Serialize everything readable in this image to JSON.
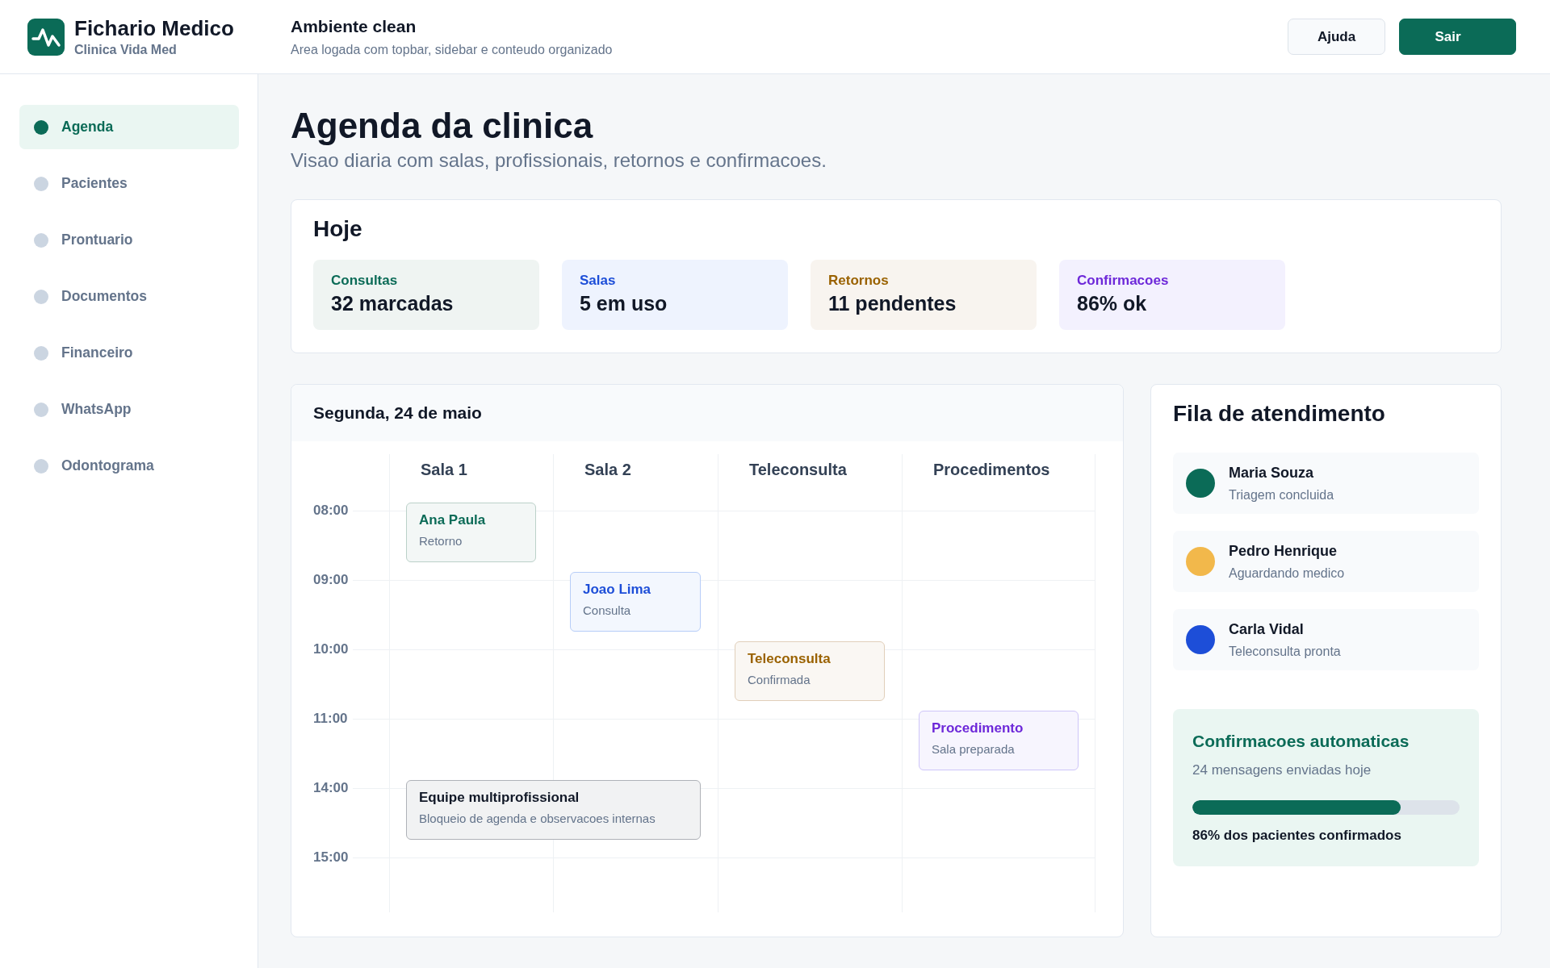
{
  "brand": {
    "title": "Fichario Medico",
    "subtitle": "Clinica Vida Med"
  },
  "topbar": {
    "title": "Ambiente clean",
    "subtitle": "Area logada com topbar, sidebar e conteudo organizado",
    "buttons": [
      {
        "label": "Ajuda",
        "kind": "secondary"
      },
      {
        "label": "Sair",
        "kind": "primary"
      }
    ]
  },
  "sidebar": {
    "items": [
      {
        "label": "Agenda",
        "selected": true
      },
      {
        "label": "Pacientes",
        "selected": false
      },
      {
        "label": "Prontuario",
        "selected": false
      },
      {
        "label": "Documentos",
        "selected": false
      },
      {
        "label": "Financeiro",
        "selected": false
      },
      {
        "label": "WhatsApp",
        "selected": false
      },
      {
        "label": "Odontograma",
        "selected": false
      }
    ]
  },
  "page": {
    "title": "Agenda da clinica",
    "subtitle": "Visao diaria com salas, profissionais, retornos e confirmacoes."
  },
  "today": {
    "title": "Hoje",
    "stats": [
      {
        "label": "Consultas",
        "value": "32 marcadas",
        "color": "#0b6b57"
      },
      {
        "label": "Salas",
        "value": "5 em uso",
        "color": "#1d4ed8"
      },
      {
        "label": "Retornos",
        "value": "11 pendentes",
        "color": "#9a6200"
      },
      {
        "label": "Confirmacoes",
        "value": "86% ok",
        "color": "#6d28d9"
      }
    ]
  },
  "calendar": {
    "date": "Segunda, 24 de maio",
    "columns": [
      "Sala 1",
      "Sala 2",
      "Teleconsulta",
      "Procedimentos"
    ],
    "rows": [
      {
        "time": "08:00",
        "slots": [
          {
            "kind": "appointment",
            "title": "Ana Paula",
            "detail": "Retorno",
            "color": "#0b6b57",
            "wide": false
          },
          {
            "kind": "free"
          },
          {
            "kind": "free"
          },
          {
            "kind": "free"
          }
        ]
      },
      {
        "time": "09:00",
        "slots": [
          {
            "kind": "free"
          },
          {
            "kind": "appointment",
            "title": "Joao Lima",
            "detail": "Consulta",
            "color": "#1d4ed8",
            "wide": false
          },
          {
            "kind": "free"
          },
          {
            "kind": "free"
          }
        ]
      },
      {
        "time": "10:00",
        "slots": [
          {
            "kind": "free"
          },
          {
            "kind": "free"
          },
          {
            "kind": "appointment",
            "title": "Teleconsulta",
            "detail": "Confirmada",
            "color": "#9a6200",
            "wide": false
          },
          {
            "kind": "free"
          }
        ]
      },
      {
        "time": "11:00",
        "slots": [
          {
            "kind": "free"
          },
          {
            "kind": "free"
          },
          {
            "kind": "free"
          },
          {
            "kind": "appointment",
            "title": "Procedimento",
            "detail": "Sala preparada",
            "color": "#6d28d9",
            "wide": false
          }
        ]
      },
      {
        "time": "14:00",
        "slots": [
          {
            "kind": "appointment",
            "title": "Equipe multiprofissional",
            "detail": "Bloqueio de agenda e observacoes internas",
            "color": "#111827",
            "wide": true
          },
          {
            "kind": "free"
          },
          {
            "kind": "free"
          },
          {
            "kind": "free"
          }
        ]
      },
      {
        "time": "15:00",
        "slots": [
          {
            "kind": "free"
          },
          {
            "kind": "free"
          },
          {
            "kind": "free"
          },
          {
            "kind": "free"
          }
        ]
      }
    ]
  },
  "queue": {
    "title": "Fila de atendimento",
    "items": [
      {
        "name": "Maria Souza",
        "status": "Triagem concluida",
        "color": "#0b6b57"
      },
      {
        "name": "Pedro Henrique",
        "status": "Aguardando medico",
        "color": "#f2b84b"
      },
      {
        "name": "Carla Vidal",
        "status": "Teleconsulta pronta",
        "color": "#1d4ed8"
      }
    ],
    "confirmations": {
      "title": "Confirmacoes automaticas",
      "text": "24 mensagens enviadas hoje",
      "level": 0.78,
      "caption": "86% dos pacientes confirmados"
    }
  }
}
